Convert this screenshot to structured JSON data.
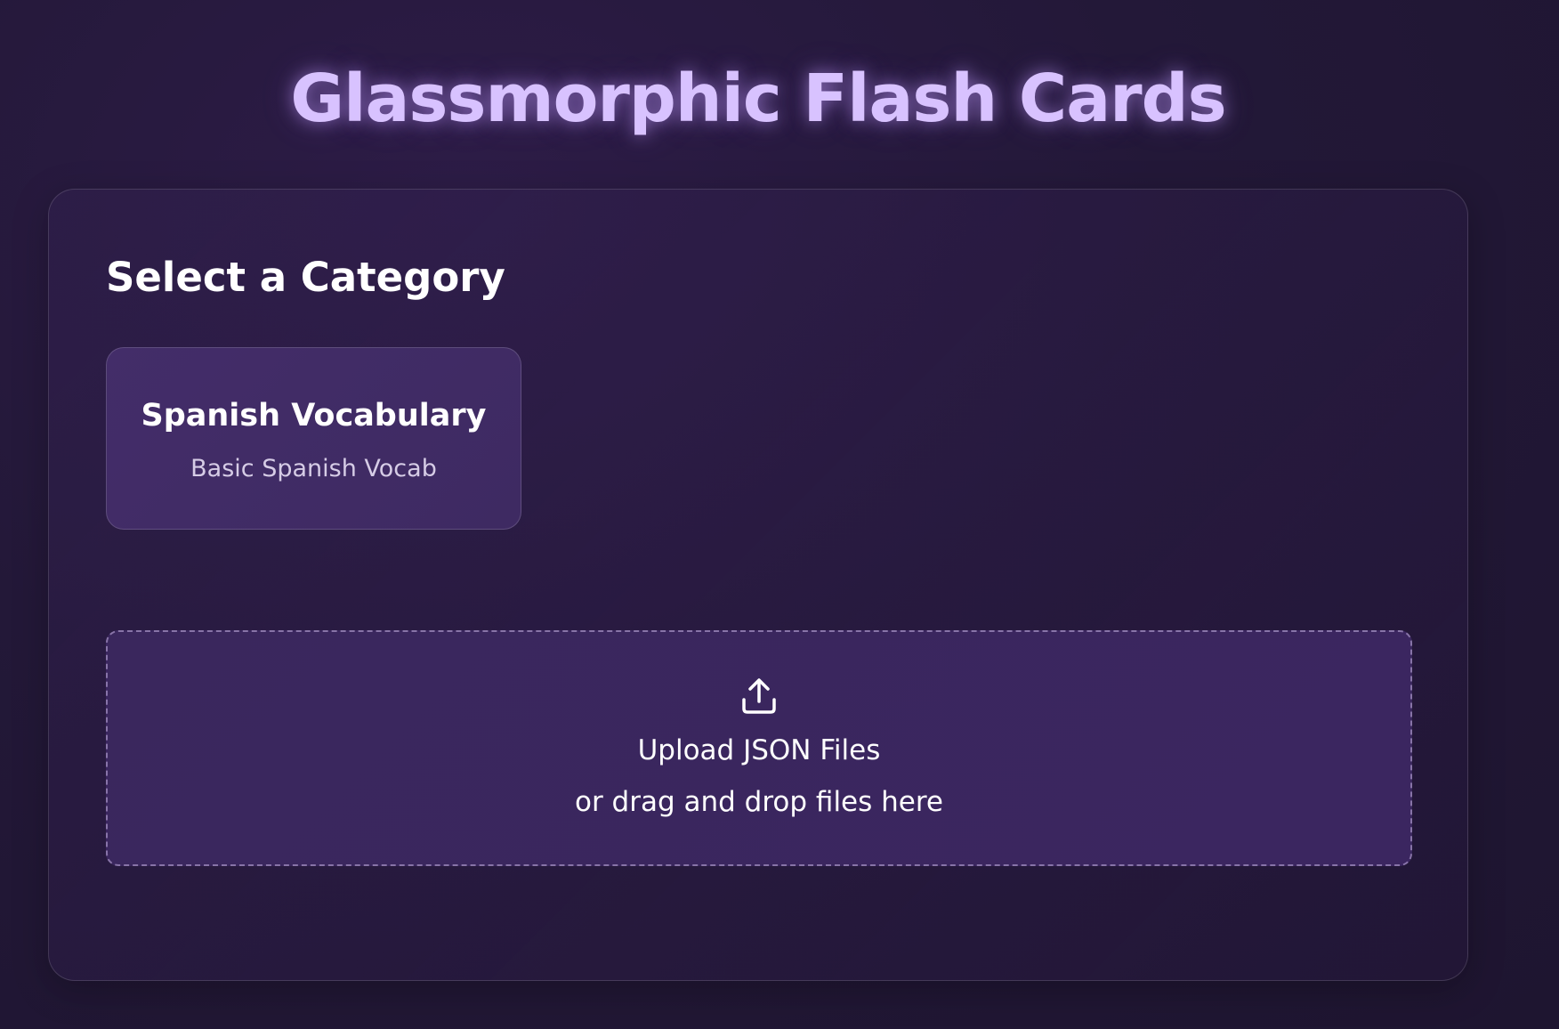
{
  "app": {
    "title": "Glassmorphic Flash Cards"
  },
  "categories": {
    "heading": "Select a Category",
    "items": [
      {
        "title": "Spanish Vocabulary",
        "description": "Basic Spanish Vocab"
      }
    ]
  },
  "upload": {
    "icon": "upload-icon",
    "label": "Upload JSON Files",
    "hint": "or drag and drop files here"
  },
  "colors": {
    "title_glow": "#d8c2ff",
    "background": "#231838",
    "card": "#432d69",
    "upload_zone": "#3a275d"
  }
}
